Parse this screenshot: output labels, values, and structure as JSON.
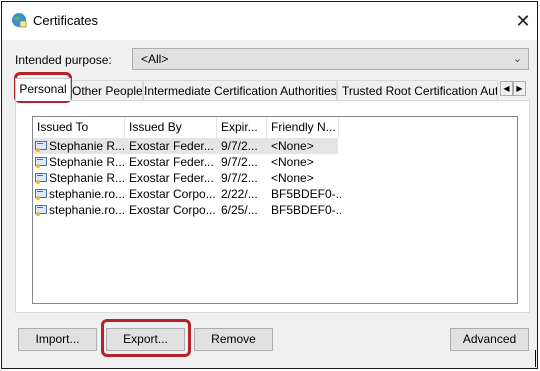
{
  "window": {
    "title": "Certificates",
    "close_icon": "close-icon",
    "app_icon": "certificate-globe-icon"
  },
  "purpose": {
    "label": "Intended purpose:",
    "value": "<All>"
  },
  "tabs": [
    {
      "label": "Personal",
      "active": true
    },
    {
      "label": "Other People",
      "active": false
    },
    {
      "label": "Intermediate Certification Authorities",
      "active": false
    },
    {
      "label": "Trusted Root Certification Auth",
      "active": false
    }
  ],
  "list": {
    "columns": [
      "Issued To",
      "Issued By",
      "Expir...",
      "Friendly N..."
    ],
    "rows": [
      {
        "issued_to": "Stephanie R...",
        "issued_by": "Exostar Feder...",
        "expiration": "9/7/2...",
        "friendly_name": "<None>",
        "selected": true
      },
      {
        "issued_to": "Stephanie R...",
        "issued_by": "Exostar Feder...",
        "expiration": "9/7/2...",
        "friendly_name": "<None>",
        "selected": false
      },
      {
        "issued_to": "Stephanie R...",
        "issued_by": "Exostar Feder...",
        "expiration": "9/7/2...",
        "friendly_name": "<None>",
        "selected": false
      },
      {
        "issued_to": "stephanie.ro...",
        "issued_by": "Exostar Corpo...",
        "expiration": "2/22/...",
        "friendly_name": "BF5BDEF0-...",
        "selected": false
      },
      {
        "issued_to": "stephanie.ro...",
        "issued_by": "Exostar Corpo...",
        "expiration": "6/25/...",
        "friendly_name": "BF5BDEF0-...",
        "selected": false
      }
    ]
  },
  "buttons": {
    "import": "Import...",
    "export": "Export...",
    "remove": "Remove",
    "advanced": "Advanced"
  },
  "colors": {
    "highlight": "#b3232b",
    "selected_row": "#e5e5e5"
  }
}
